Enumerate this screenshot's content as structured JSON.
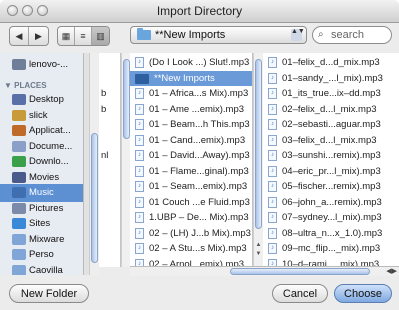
{
  "window": {
    "title": "Import Directory"
  },
  "toolbar": {
    "back_label": "◀",
    "forward_label": "▶",
    "view_icon_label": "▦",
    "view_list_label": "≡",
    "view_column_label": "▥",
    "location_label": "**New Imports",
    "location_arrows": "▲▼",
    "search_placeholder": "search"
  },
  "sidebar": {
    "devices": [
      {
        "label": "lenovo-...",
        "icon": "drive-icon",
        "color": "#6f7f99"
      }
    ],
    "places_header": "▼ PLACES",
    "places": [
      {
        "label": "Desktop",
        "icon": "desktop-icon",
        "color": "#5a6fa8"
      },
      {
        "label": "slick",
        "icon": "home-icon",
        "color": "#c89a3a"
      },
      {
        "label": "Applicat...",
        "icon": "applications-icon",
        "color": "#c06a2a"
      },
      {
        "label": "Docume...",
        "icon": "documents-icon",
        "color": "#8aa0c8"
      },
      {
        "label": "Downlo...",
        "icon": "downloads-icon",
        "color": "#3aa04a"
      },
      {
        "label": "Movies",
        "icon": "movies-icon",
        "color": "#4a5a8a"
      },
      {
        "label": "Music",
        "icon": "music-icon",
        "color": "#3f6fb0",
        "selected": true
      },
      {
        "label": "Pictures",
        "icon": "pictures-icon",
        "color": "#7a8aa8"
      },
      {
        "label": "Sites",
        "icon": "sites-icon",
        "color": "#3a88d8"
      },
      {
        "label": "Mixware",
        "icon": "folder-icon",
        "color": "#7fa6d6"
      },
      {
        "label": "Perso",
        "icon": "folder-icon",
        "color": "#7fa6d6"
      },
      {
        "label": "Caovilla",
        "icon": "folder-icon",
        "color": "#7fa6d6"
      }
    ]
  },
  "column0": {
    "items": [
      "",
      "",
      "b",
      "b",
      "",
      "",
      "nl",
      "",
      "",
      "",
      "",
      "",
      "",
      "",
      ""
    ]
  },
  "column1": {
    "items": [
      "(Do I Look ...) Slut!.mp3",
      "**New Imports",
      "01 – Africa...s Mix).mp3",
      "01 – Ame ...emix).mp3",
      "01 – Beam...h This.mp3",
      "01 – Cand...emix).mp3",
      "01 – David...Away).mp3",
      "01 – Flame...ginal).mp3",
      "01 – Seam...emix).mp3",
      "01 Couch ...e Fluid.mp3",
      "1.UBP – De... Mix).mp3",
      "02 – (LH) J...b Mix).mp3",
      "02 – A Stu...s Mix).mp3",
      "02 – Arnol...emix).mp3"
    ],
    "selected_index": 1
  },
  "column2": {
    "items": [
      "01–felix_d...d_mix.mp3",
      "01–sandy_...l_mix).mp3",
      "01_its_true...ix–dd.mp3",
      "02–felix_d...l_mix.mp3",
      "02–sebasti...aguar.mp3",
      "03–felix_d...l_mix.mp3",
      "03–sunshi...remix).mp3",
      "04–eric_pr...l_mix).mp3",
      "05–fischer...remix).mp3",
      "06–john_a...remix).mp3",
      "07–sydney...l_mix).mp3",
      "08–ultra_n...x_1.0).mp3",
      "09–mc_flip..._mix).mp3",
      "10–d–rami..._mix).mp3"
    ]
  },
  "buttons": {
    "new_folder": "New Folder",
    "cancel": "Cancel",
    "choose": "Choose"
  }
}
